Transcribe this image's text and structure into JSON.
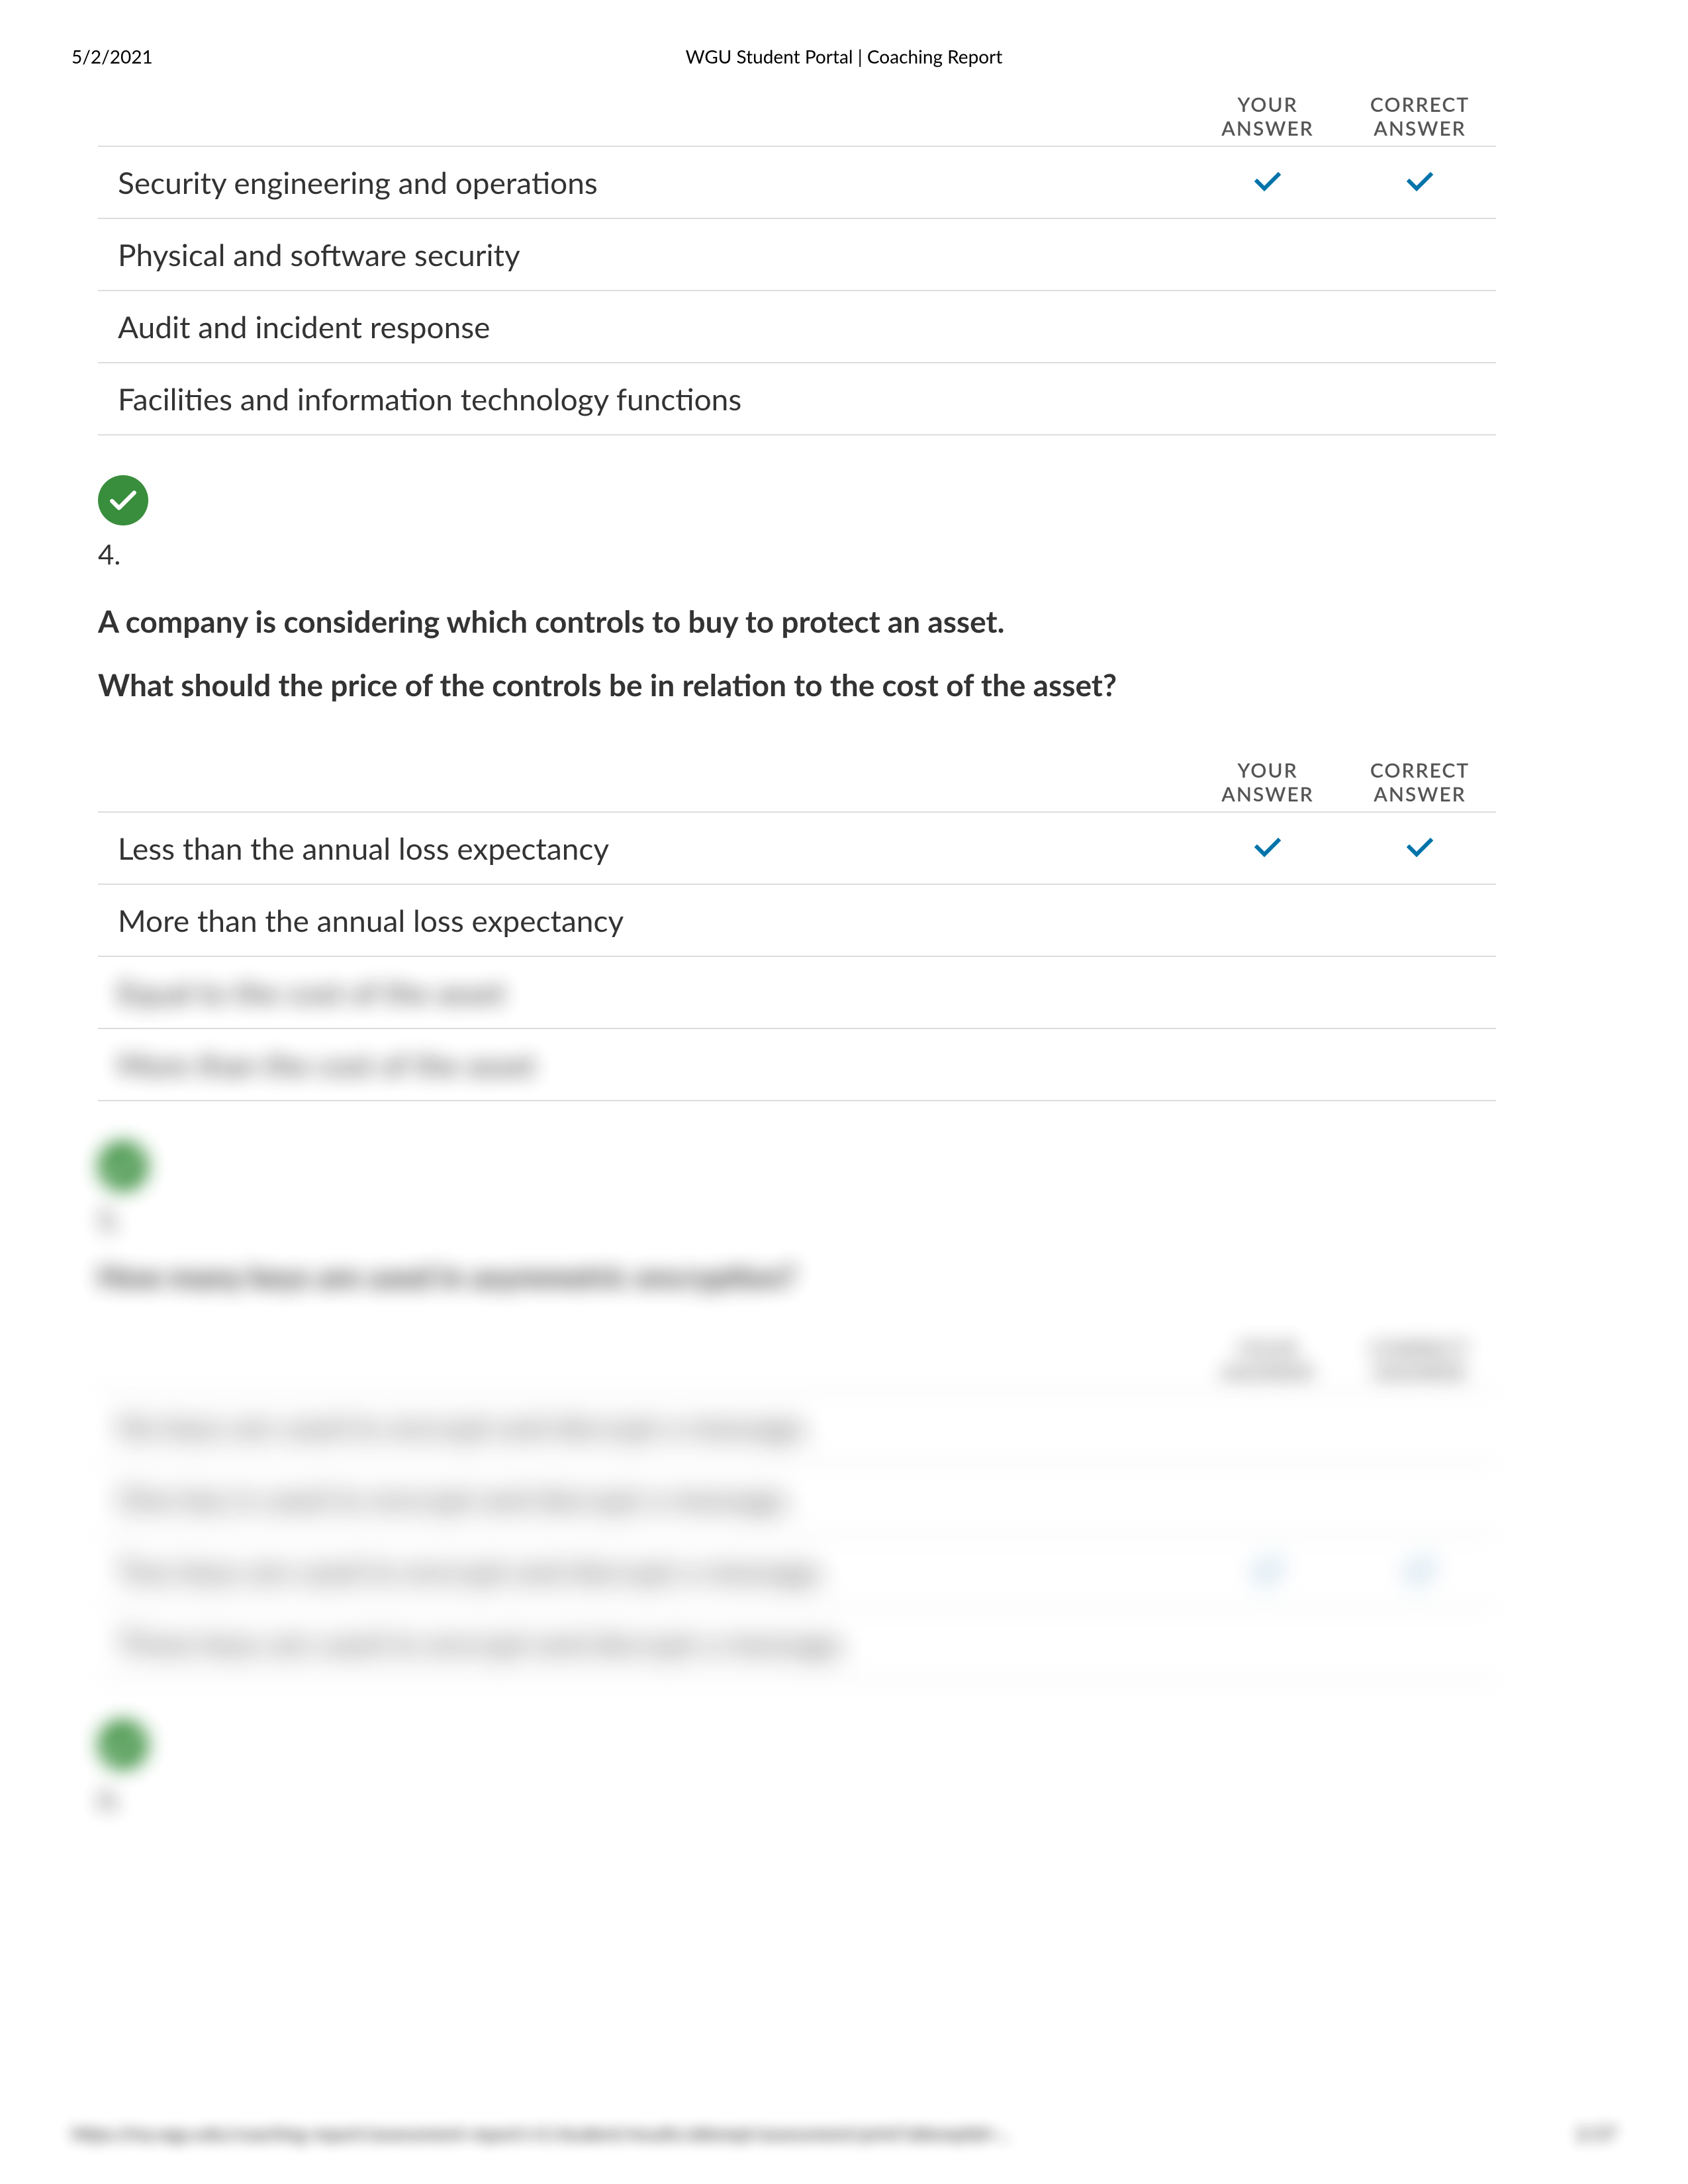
{
  "header": {
    "date": "5/2/2021",
    "title": "WGU Student Portal | Coaching Report"
  },
  "colHeaders": {
    "your_line1": "YOUR",
    "your_line2": "ANSWER",
    "correct_line1": "CORRECT",
    "correct_line2": "ANSWER"
  },
  "q3_options": [
    {
      "text": "Security engineering and operations",
      "your": true,
      "correct": true
    },
    {
      "text": "Physical and software security",
      "your": false,
      "correct": false
    },
    {
      "text": "Audit and incident response",
      "your": false,
      "correct": false
    },
    {
      "text": "Facilities and information technology functions",
      "your": false,
      "correct": false
    }
  ],
  "q4": {
    "number": "4.",
    "stem_p1": "A company is considering which controls to buy to protect an asset.",
    "stem_p2": "What should the price of the controls be in relation to the cost of the asset?",
    "options": [
      {
        "text": "Less than the annual loss expectancy",
        "your": true,
        "correct": true
      },
      {
        "text": "More than the annual loss expectancy",
        "your": false,
        "correct": false
      },
      {
        "text": "Equal to the cost of the asset",
        "your": false,
        "correct": false,
        "blur": true
      },
      {
        "text": "More than the cost of the asset",
        "your": false,
        "correct": false,
        "blur": true
      }
    ]
  },
  "q5": {
    "number": "5.",
    "stem_p1": "How many keys are used in asymmetric encryption?",
    "options": [
      {
        "text": "No keys are used to encrypt and decrypt a message.",
        "your": false,
        "correct": false
      },
      {
        "text": "One key is used to encrypt and decrypt a message.",
        "your": false,
        "correct": false
      },
      {
        "text": "Two keys are used to encrypt and decrypt a message.",
        "your": true,
        "correct": true
      },
      {
        "text": "Three keys are used to encrypt and decrypt a message.",
        "your": false,
        "correct": false
      }
    ]
  },
  "q6": {
    "number": "6."
  },
  "footer": {
    "url_text": "https://my.wgu.edu/coaching-report/assessment-report/v1/student/results/attempt/assessment/print?attemptId=...",
    "page": "2/27"
  }
}
